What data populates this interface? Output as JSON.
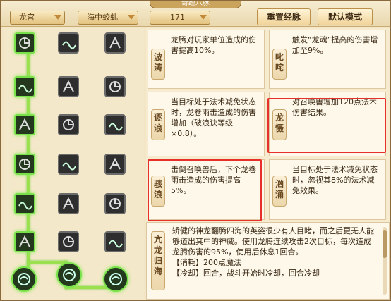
{
  "window": {
    "title": "奇经八脉"
  },
  "toolbar": {
    "school_select": "龙宫",
    "mount_select": "海中蛟虬",
    "level_select": "171",
    "reset_button": "重置经脉",
    "default_button": "默认模式"
  },
  "tree": {
    "icons": [
      "dragon-rune-icon",
      "wave-rune-icon",
      "fist-rune-icon",
      "dragon-head-icon",
      "claw-icon",
      "dagger-icon",
      "wave-icon",
      "serpent-icon",
      "tiger-icon",
      "rooster-icon",
      "bird-icon",
      "blade-icon",
      "scroll-icon",
      "scroll-icon",
      "shell-icon",
      "dragon-rider-icon",
      "dragon-coil-icon",
      "feather-icon",
      "orb-icon",
      "dragon-orb-icon",
      "orb-icon"
    ]
  },
  "skills": {
    "bo_tao": {
      "name": "波涛",
      "text": "龙腾对玩家单位造成的伤害提高10%。"
    },
    "chi_zha": {
      "name": "叱咤",
      "text": "触发“龙魂”提高的伤害增加至9%。"
    },
    "zhu_lang": {
      "name": "逐浪",
      "text": "当目标处于法术减免状态时，龙卷雨击造成的伤害增加（破浪诀等级×0.8）。"
    },
    "long_xi": {
      "name": "龙慑",
      "text": "对召唤兽增加120点法术伤害结果。"
    },
    "hai_lang": {
      "name": "骇浪",
      "text": "击倒召唤兽后，下个龙卷雨击造成的伤害提高5%。"
    },
    "xiong_yong": {
      "name": "汹涌",
      "text": "当目标处于法术减免状态时，忽视其8%的法术减免效果。"
    }
  },
  "ultimate": {
    "name": "亢龙归海",
    "desc": "矫健的神龙翻腾四海的英姿很少有人目睹，而之后更无人能够道出其中的神威。使用龙腾连续攻击2次目标，每次造成龙腾伤害的95%，使用后休息1回合。",
    "cost": "【消耗】200点魔法",
    "cut": "【冷却】回合，战斗开始时冷却，回合冷却"
  }
}
